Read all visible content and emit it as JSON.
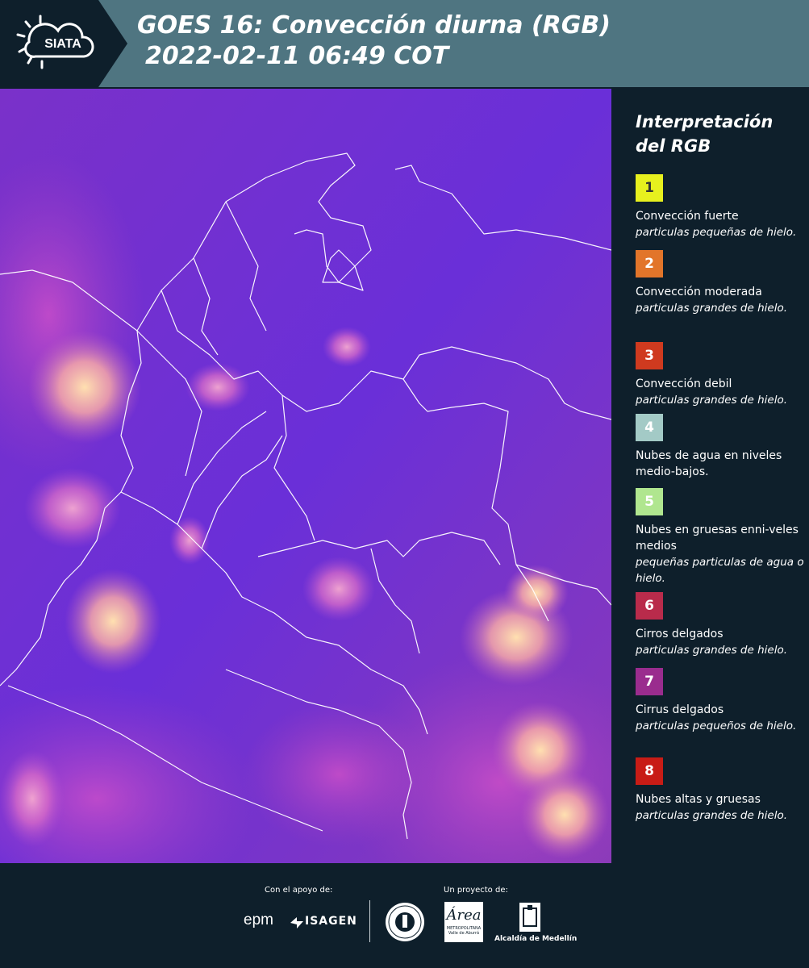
{
  "header": {
    "logo_text": "SIATA",
    "title_line1": "GOES 16: Convección diurna (RGB)",
    "title_line2": "2022-02-11 06:49 COT"
  },
  "legend": {
    "title_line1": "Interpretación",
    "title_line2": "del RGB",
    "items": [
      {
        "num": "1",
        "color": "#e7f01e",
        "text_color": "#333333",
        "label": "Convección fuerte",
        "desc": "particulas pequeñas de hielo."
      },
      {
        "num": "2",
        "color": "#e2752a",
        "text_color": "#ffffff",
        "label": "Convección moderada",
        "desc": "particulas grandes de hielo."
      },
      {
        "num": "3",
        "color": "#cf3a1f",
        "text_color": "#ffffff",
        "label": "Convección debil",
        "desc": "particulas grandes de hielo."
      },
      {
        "num": "4",
        "color": "#a3cac6",
        "text_color": "#ffffff",
        "label": "Nubes de agua en niveles medio-bajos.",
        "desc": ""
      },
      {
        "num": "5",
        "color": "#b0e68f",
        "text_color": "#ffffff",
        "label": "Nubes en gruesas enni-veles medios",
        "desc": "pequeñas particulas de agua o hielo."
      },
      {
        "num": "6",
        "color": "#b92b4b",
        "text_color": "#ffffff",
        "label": "Cirros delgados",
        "desc": "particulas grandes de hielo."
      },
      {
        "num": "7",
        "color": "#9a2c8e",
        "text_color": "#ffffff",
        "label": "Cirrus delgados",
        "desc": "particulas pequeños de hielo."
      },
      {
        "num": "8",
        "color": "#c81c16",
        "text_color": "#ffffff",
        "label": "Nubes altas y gruesas",
        "desc": "particulas grandes de hielo."
      }
    ]
  },
  "footer": {
    "support_label": "Con el apoyo de:",
    "project_label": "Un proyecto de:",
    "sponsor1": "epm",
    "sponsor2": "ISAGEN",
    "partner_area": "Área",
    "partner_area_sub1": "METROPOLITANA",
    "partner_area_sub2": "Valle de Aburrá",
    "partner_alcaldia": "Alcaldía de Medellín"
  }
}
